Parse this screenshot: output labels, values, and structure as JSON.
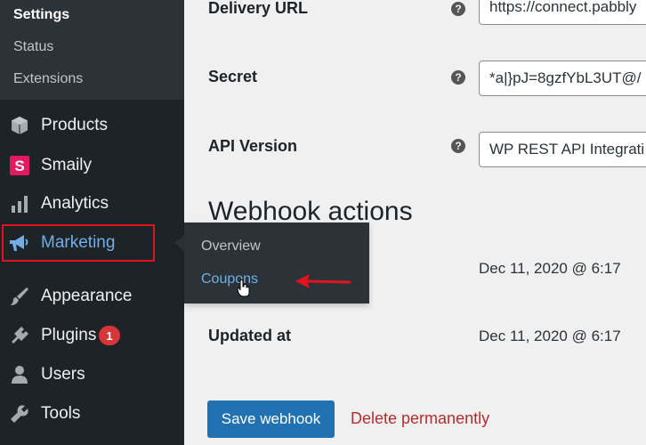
{
  "sidebar": {
    "submenu": [
      {
        "label": "Settings",
        "current": true
      },
      {
        "label": "Status",
        "current": false
      },
      {
        "label": "Extensions",
        "current": false
      }
    ],
    "items": [
      {
        "label": "Products",
        "icon": "products-icon"
      },
      {
        "label": "Smaily",
        "icon": "smaily-icon"
      },
      {
        "label": "Analytics",
        "icon": "analytics-icon"
      },
      {
        "label": "Marketing",
        "icon": "megaphone-icon",
        "active": true
      },
      {
        "label": "Appearance",
        "icon": "paintbrush-icon"
      },
      {
        "label": "Plugins",
        "icon": "plugin-icon",
        "badge": "1"
      },
      {
        "label": "Users",
        "icon": "users-icon"
      },
      {
        "label": "Tools",
        "icon": "wrench-icon"
      }
    ]
  },
  "flyout": {
    "items": [
      {
        "label": "Overview"
      },
      {
        "label": "Coupons",
        "hover": true
      }
    ]
  },
  "form": {
    "delivery_url": {
      "label": "Delivery URL",
      "value": "https://connect.pabbly"
    },
    "secret": {
      "label": "Secret",
      "value": "*a|}pJ=8gzfYbL3UT@/"
    },
    "api_version": {
      "label": "API Version",
      "value": "WP REST API Integrati"
    }
  },
  "webhook_actions": {
    "title": "Webhook actions",
    "created_value": "Dec 11, 2020 @ 6:17",
    "updated_label": "Updated at",
    "updated_value": "Dec 11, 2020 @ 6:17"
  },
  "actions": {
    "save_label": "Save webhook",
    "delete_label": "Delete permanently"
  },
  "colors": {
    "sidebar_bg": "#1d2327",
    "accent": "#72aee6",
    "primary_button": "#2271b1",
    "delete_link": "#b32d2e",
    "annotation_red": "#e0131f"
  }
}
